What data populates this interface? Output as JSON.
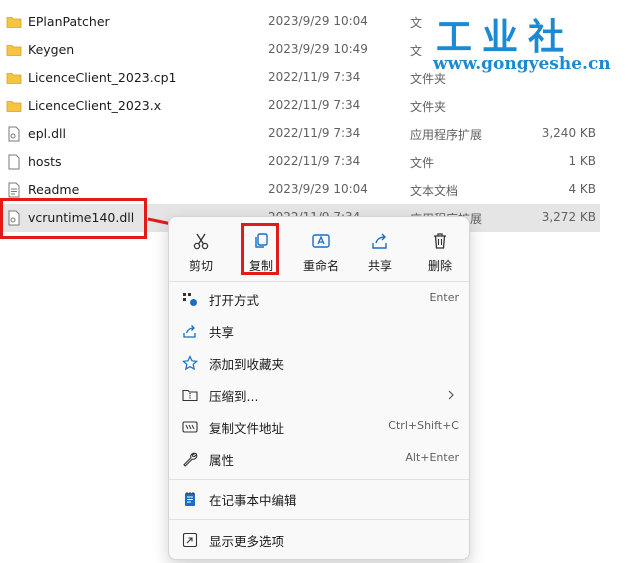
{
  "files": [
    {
      "name": "EPlanPatcher",
      "date": "2023/9/29 10:04",
      "type": "文",
      "size": "",
      "icon": "folder-icon"
    },
    {
      "name": "Keygen",
      "date": "2023/9/29 10:49",
      "type": "文",
      "size": "",
      "icon": "folder-icon"
    },
    {
      "name": "LicenceClient_2023.cp1",
      "date": "2022/11/9 7:34",
      "type": "文件夹",
      "size": "",
      "icon": "folder-icon"
    },
    {
      "name": "LicenceClient_2023.x",
      "date": "2022/11/9 7:34",
      "type": "文件夹",
      "size": "",
      "icon": "folder-icon"
    },
    {
      "name": "epl.dll",
      "date": "2022/11/9 7:34",
      "type": "应用程序扩展",
      "size": "3,240 KB",
      "icon": "dll-file-icon"
    },
    {
      "name": "hosts",
      "date": "2022/11/9 7:34",
      "type": "文件",
      "size": "1 KB",
      "icon": "file-icon"
    },
    {
      "name": "Readme",
      "date": "2023/9/29 10:04",
      "type": "文本文档",
      "size": "4 KB",
      "icon": "text-file-icon"
    },
    {
      "name": "vcruntime140.dll",
      "date": "2022/11/9 7:34",
      "type": "应用程序扩展",
      "size": "3,272 KB",
      "icon": "dll-file-icon"
    }
  ],
  "watermark": {
    "title": "工业社",
    "url": "www.gongyeshe.cn"
  },
  "context_menu": {
    "quick_actions": [
      {
        "label": "剪切",
        "icon": "scissors-icon"
      },
      {
        "label": "复制",
        "icon": "copy-icon"
      },
      {
        "label": "重命名",
        "icon": "rename-icon"
      },
      {
        "label": "共享",
        "icon": "share-icon"
      },
      {
        "label": "删除",
        "icon": "trash-icon"
      }
    ],
    "items": [
      {
        "label": "打开方式",
        "shortcut": "Enter",
        "icon": "open-with-icon"
      },
      {
        "label": "共享",
        "shortcut": "",
        "icon": "share-icon"
      },
      {
        "label": "添加到收藏夹",
        "shortcut": "",
        "icon": "star-icon"
      },
      {
        "label": "压缩到...",
        "shortcut": "",
        "icon": "zip-folder-icon",
        "submenu": true
      },
      {
        "label": "复制文件地址",
        "shortcut": "Ctrl+Shift+C",
        "icon": "copy-path-icon"
      },
      {
        "label": "属性",
        "shortcut": "Alt+Enter",
        "icon": "wrench-icon"
      },
      {
        "label": "在记事本中编辑",
        "shortcut": "",
        "icon": "notepad-icon"
      },
      {
        "label": "显示更多选项",
        "shortcut": "",
        "icon": "more-options-icon"
      }
    ]
  },
  "colors": {
    "accent": "#1b8ad2",
    "highlight": "#e21a1a",
    "folder": "#f5c542",
    "selection": "#e5e5e5"
  }
}
